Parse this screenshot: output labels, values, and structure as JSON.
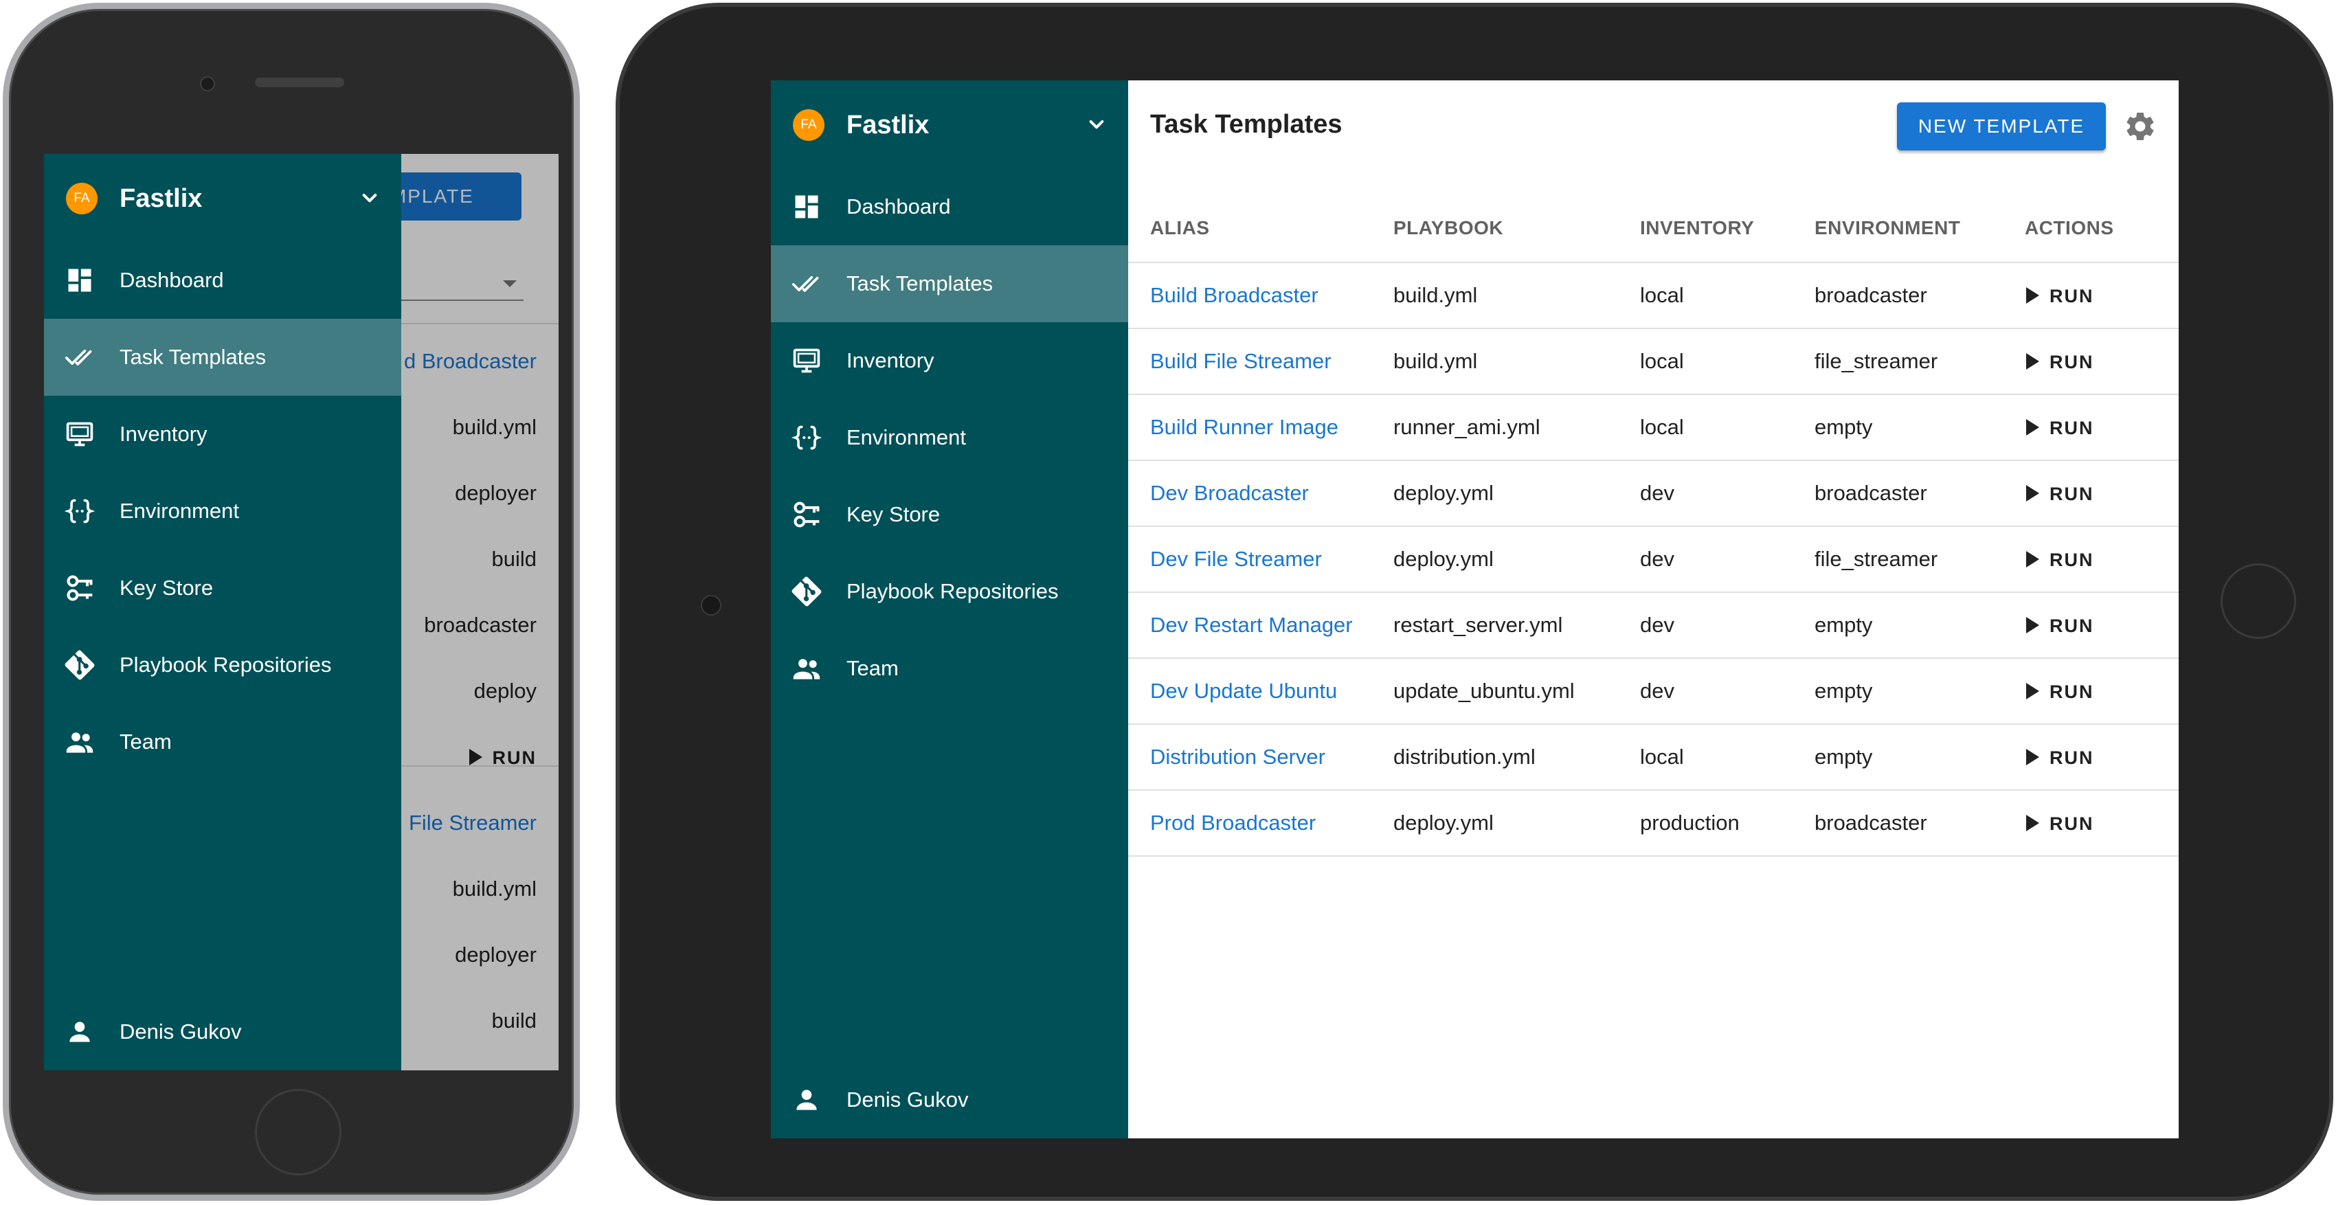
{
  "sidebar": {
    "avatar_initials": "FA",
    "app_name": "Fastlix",
    "items": [
      {
        "label": "Dashboard",
        "icon": "dashboard-icon"
      },
      {
        "label": "Task Templates",
        "icon": "double-check-icon",
        "active": true
      },
      {
        "label": "Inventory",
        "icon": "monitor-icon"
      },
      {
        "label": "Environment",
        "icon": "braces-icon"
      },
      {
        "label": "Key Store",
        "icon": "key-icon"
      },
      {
        "label": "Playbook Repositories",
        "icon": "git-icon"
      },
      {
        "label": "Team",
        "icon": "people-icon"
      }
    ],
    "user_name": "Denis Gukov"
  },
  "header": {
    "title": "Task Templates",
    "new_template_label": "NEW TEMPLATE"
  },
  "table": {
    "columns": [
      "ALIAS",
      "PLAYBOOK",
      "INVENTORY",
      "ENVIRONMENT",
      "ACTIONS"
    ],
    "run_label": "RUN",
    "rows": [
      {
        "alias": "Build Broadcaster",
        "playbook": "build.yml",
        "inventory": "local",
        "environment": "broadcaster"
      },
      {
        "alias": "Build File Streamer",
        "playbook": "build.yml",
        "inventory": "local",
        "environment": "file_streamer"
      },
      {
        "alias": "Build Runner Image",
        "playbook": "runner_ami.yml",
        "inventory": "local",
        "environment": "empty"
      },
      {
        "alias": "Dev Broadcaster",
        "playbook": "deploy.yml",
        "inventory": "dev",
        "environment": "broadcaster"
      },
      {
        "alias": "Dev File Streamer",
        "playbook": "deploy.yml",
        "inventory": "dev",
        "environment": "file_streamer"
      },
      {
        "alias": "Dev Restart Manager",
        "playbook": "restart_server.yml",
        "inventory": "dev",
        "environment": "empty"
      },
      {
        "alias": "Dev Update Ubuntu",
        "playbook": "update_ubuntu.yml",
        "inventory": "dev",
        "environment": "empty"
      },
      {
        "alias": "Distribution Server",
        "playbook": "distribution.yml",
        "inventory": "local",
        "environment": "empty"
      },
      {
        "alias": "Prod Broadcaster",
        "playbook": "deploy.yml",
        "inventory": "production",
        "environment": "broadcaster"
      }
    ]
  },
  "phone_behind": {
    "button_label": "TEMPLATE",
    "cells": [
      {
        "text": "d Broadcaster",
        "type": "alias"
      },
      {
        "text": "build.yml",
        "type": "value"
      },
      {
        "text": "deployer",
        "type": "value"
      },
      {
        "text": "build",
        "type": "value"
      },
      {
        "text": "broadcaster",
        "type": "value"
      },
      {
        "text": "deploy",
        "type": "value"
      },
      {
        "text": "RUN",
        "type": "run"
      },
      {
        "text": "File Streamer",
        "type": "alias"
      },
      {
        "text": "build.yml",
        "type": "value"
      },
      {
        "text": "deployer",
        "type": "value"
      },
      {
        "text": "build",
        "type": "value"
      }
    ]
  },
  "colors": {
    "sidebar_bg": "#005057",
    "accent_blue": "#1976d2",
    "avatar_orange": "#ff9800"
  }
}
